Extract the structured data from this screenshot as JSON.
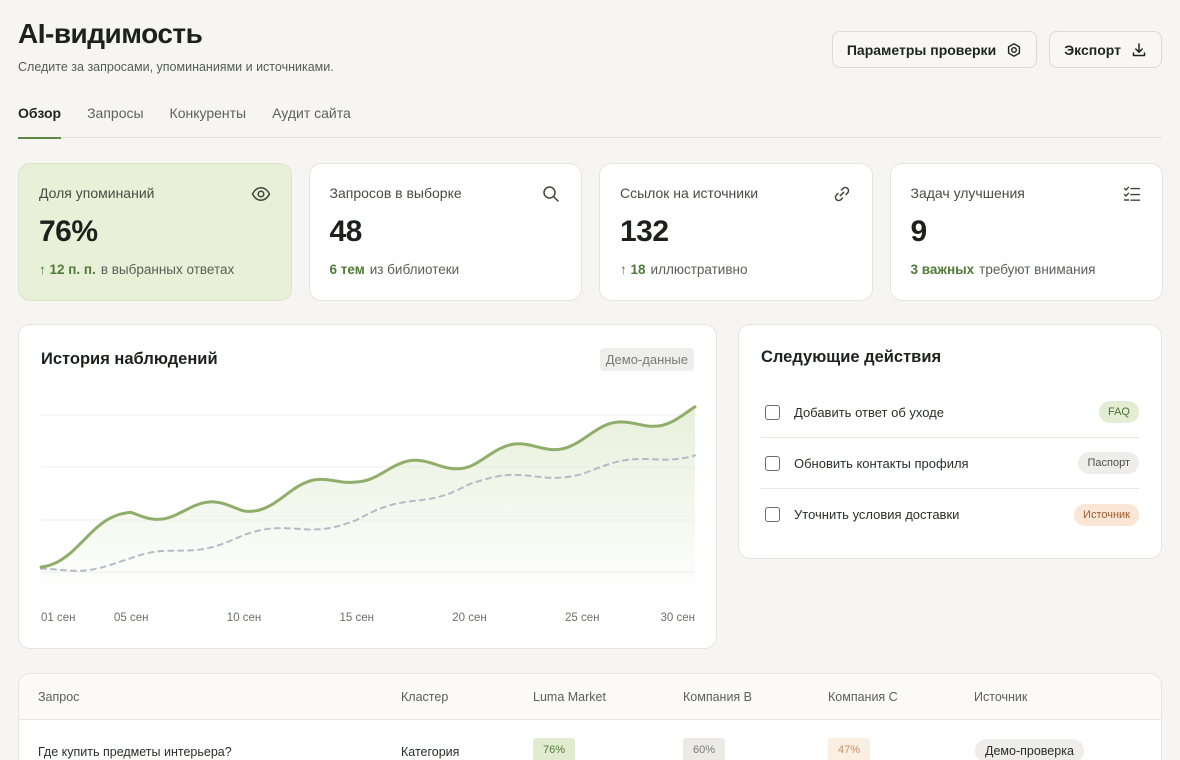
{
  "header": {
    "title": "AI-видимость",
    "subtitle": "Следите за запросами, упоминаниями и источниками.",
    "params_button": "Параметры проверки",
    "export_button": "Экспорт"
  },
  "tabs": [
    {
      "label": "Обзор",
      "active": true
    },
    {
      "label": "Запросы",
      "active": false
    },
    {
      "label": "Конкуренты",
      "active": false
    },
    {
      "label": "Аудит сайта",
      "active": false
    }
  ],
  "kpis": [
    {
      "label": "Доля упоминаний",
      "value": "76%",
      "accent": "↑ 12 п. п.",
      "note": "в выбранных ответах",
      "icon": "eye-icon"
    },
    {
      "label": "Запросов в выборке",
      "value": "48",
      "accent": "6 тем",
      "note": "из библиотеки",
      "icon": "search-icon"
    },
    {
      "label": "Ссылок на источники",
      "value": "132",
      "accent": "↑ 18",
      "note": "иллюстративно",
      "icon": "link-icon"
    },
    {
      "label": "Задач улучшения",
      "value": "9",
      "accent": "3 важных",
      "note": "требуют внимания",
      "icon": "checklist-icon"
    }
  ],
  "history": {
    "title": "История наблюдений",
    "badge": "Демо-данные"
  },
  "chart_data": {
    "type": "area",
    "x_tick_labels": [
      "01 сен",
      "05 сен",
      "10 сен",
      "15 сен",
      "20 сен",
      "25 сен",
      "30 сен"
    ],
    "x": [
      1,
      5,
      10,
      15,
      20,
      25,
      30
    ],
    "series": [
      {
        "style": "solid-area",
        "color": "#8fae6a",
        "values": [
          0.05,
          0.36,
          0.4,
          0.6,
          0.69,
          0.83,
          1.0
        ]
      },
      {
        "style": "dashed",
        "color": "#b9b8c8",
        "values": [
          0.0,
          0.07,
          0.22,
          0.32,
          0.55,
          0.62,
          0.74
        ]
      }
    ],
    "grid": true,
    "colors": {
      "line": "#8fae6a",
      "area": "#e6efd9",
      "dashed": "#b9b8c8"
    }
  },
  "next_actions": {
    "title": "Следующие действия",
    "items": [
      {
        "label": "Добавить ответ об уходе",
        "tag": "FAQ",
        "tag_style": "green"
      },
      {
        "label": "Обновить контакты профиля",
        "tag": "Паспорт",
        "tag_style": "grey"
      },
      {
        "label": "Уточнить условия доставки",
        "tag": "Источник",
        "tag_style": "orange"
      }
    ]
  },
  "table": {
    "headers": [
      "Запрос",
      "Кластер",
      "Luma Market",
      "Компания B",
      "Компания C",
      "Источник"
    ],
    "rows": [
      {
        "query": "Где купить предметы интерьера?",
        "cluster": "Категория",
        "luma": "76%",
        "b": "60%",
        "c": "47%",
        "source": "Демо-проверка"
      }
    ]
  }
}
